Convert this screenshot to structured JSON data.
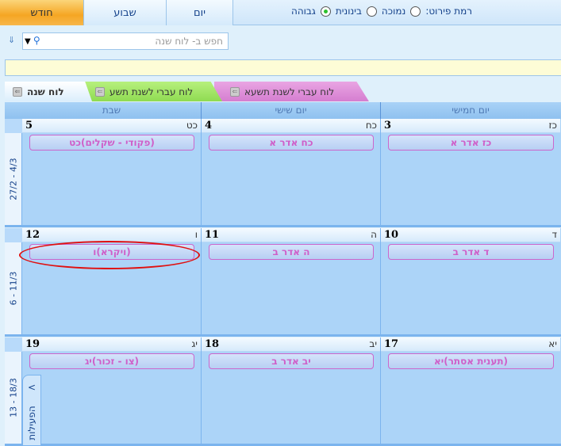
{
  "toolbar": {
    "views": {
      "month": "חודש",
      "week": "שבוע",
      "day": "יום"
    },
    "detail_label": "רמת פירוט:",
    "detail_options": [
      "נמוכה",
      "בינונית",
      "גבוהה"
    ],
    "detail_selected": "גבוהה"
  },
  "search": {
    "placeholder": "חפש ב- לוח שנה"
  },
  "tabs": [
    {
      "label": "לוח שנה",
      "color": "#dbeefc"
    },
    {
      "label": "לוח עברי לשנת תשע",
      "color": "#8fdb52"
    },
    {
      "label": "לוח עברי לשנת תשעא",
      "color": "#d57ed0"
    }
  ],
  "columns": [
    "שבת",
    "יום שישי",
    "יום חמישי"
  ],
  "weeks": [
    {
      "label": "27/2 - 4/3",
      "days": [
        {
          "num": "5",
          "heb": "כט",
          "event": "(פקודי - שקלים)כט"
        },
        {
          "num": "4",
          "heb": "כח",
          "event": "כח אדר א"
        },
        {
          "num": "3",
          "heb": "כז",
          "event": "כז אדר א"
        }
      ]
    },
    {
      "label": "6 - 11/3",
      "days": [
        {
          "num": "12",
          "heb": "ו",
          "event": "(ויקרא)ו"
        },
        {
          "num": "11",
          "heb": "ה",
          "event": "ה אדר ב"
        },
        {
          "num": "10",
          "heb": "ד",
          "event": "ד אדר ב"
        }
      ]
    },
    {
      "label": "13 - 18/3",
      "days": [
        {
          "num": "19",
          "heb": "יג",
          "event": "(צו - זכור)יג"
        },
        {
          "num": "18",
          "heb": "יב",
          "event": "יב אדר ב"
        },
        {
          "num": "17",
          "heb": "יא",
          "event": "(תענית אסתר)יא"
        }
      ]
    }
  ],
  "side_panel": {
    "label": "הפעילות"
  },
  "colors": {
    "accent": "#f5a623",
    "calendar_bg": "#acd4f8",
    "event_text": "#cf5fc9",
    "highlight": "#e01010"
  }
}
